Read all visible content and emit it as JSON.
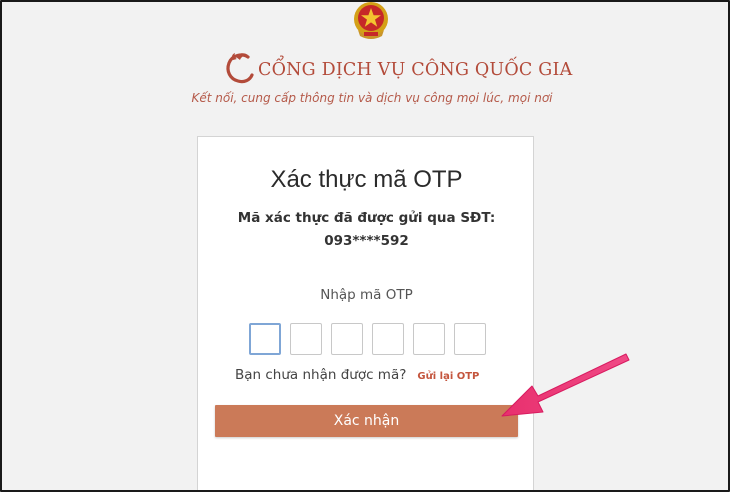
{
  "header": {
    "logo_text": "CỔNG DỊCH VỤ CÔNG QUỐC GIA",
    "tagline": "Kết nối, cung cấp thông tin và dịch vụ công mọi lúc, mọi nơi"
  },
  "otp_card": {
    "title": "Xác thực mã OTP",
    "sent_message": "Mã xác thực đã được gửi qua SĐT:",
    "phone_masked": "093****592",
    "enter_label": "Nhập mã OTP",
    "digits": [
      "",
      "",
      "",
      "",
      "",
      ""
    ],
    "resend_question": "Bạn chưa nhận được mã?",
    "resend_link": "Gửi lại OTP",
    "confirm_label": "Xác nhận"
  },
  "colors": {
    "brand": "#b34b3a",
    "button": "#cb7a58",
    "annotation_arrow": "#e8306e",
    "active_box_border": "#7fa6d6"
  },
  "icons": {
    "emblem": "national-emblem-icon",
    "logo_mark": "phoenix-logo-icon"
  }
}
